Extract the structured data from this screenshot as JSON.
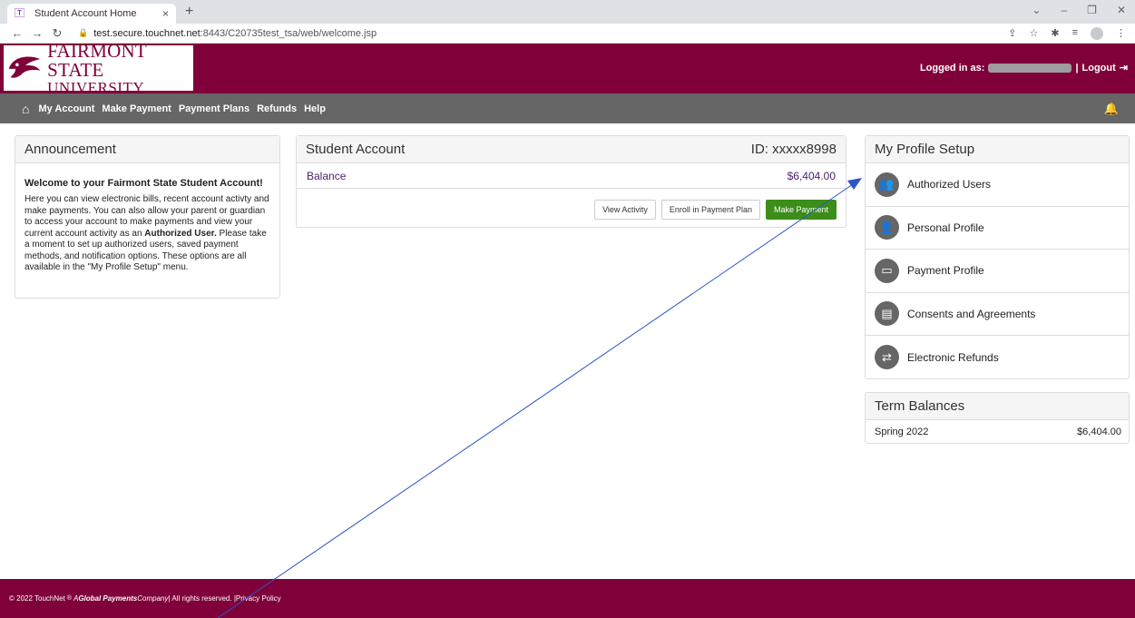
{
  "browser": {
    "tab_title": "Student Account Home",
    "tab_close": "×",
    "new_tab": "+",
    "url_host": "test.secure.touchnet.net",
    "url_rest": ":8443/C20735test_tsa/web/welcome.jsp"
  },
  "header": {
    "logo_line1": "FAIRMONT STATE",
    "logo_line2": "UNIVERSITY",
    "logged_in_label": "Logged in as:",
    "logout_label": "Logout",
    "brand_color": "#80003a"
  },
  "nav": {
    "items": [
      "My Account",
      "Make Payment",
      "Payment Plans",
      "Refunds",
      "Help"
    ]
  },
  "announcement": {
    "title": "Announcement",
    "welcome": "Welcome to your Fairmont State Student Account!",
    "body_part1": "Here you can view electronic bills, recent account activty and make payments.  You can also allow your parent or guardian to access your account to make payments and view your current account activity as an ",
    "body_bold": "Authorized User.",
    "body_part2": "  Please take a moment to set up authorized users, saved payment methods, and notification options.  These options are all available in the \"My Profile Setup\" menu."
  },
  "student_account": {
    "title": "Student Account",
    "id_label": "ID: xxxxx8998",
    "balance_label": "Balance",
    "balance_value": "$6,404.00",
    "buttons": {
      "view_activity": "View Activity",
      "enroll": "Enroll in Payment Plan",
      "make_payment": "Make Payment"
    }
  },
  "profile_setup": {
    "title": "My Profile Setup",
    "items": [
      {
        "label": "Authorized Users",
        "icon": "users-icon"
      },
      {
        "label": "Personal Profile",
        "icon": "person-icon"
      },
      {
        "label": "Payment Profile",
        "icon": "credit-card-icon"
      },
      {
        "label": "Consents and Agreements",
        "icon": "document-icon"
      },
      {
        "label": "Electronic Refunds",
        "icon": "refund-icon"
      }
    ]
  },
  "term_balances": {
    "title": "Term Balances",
    "rows": [
      {
        "term": "Spring 2022",
        "amount": "$6,404.00"
      }
    ]
  },
  "footer": {
    "copyright": "© 2022 TouchNet",
    "reg": "®",
    "company_italic_a": "A ",
    "company_bold": "Global Payments",
    "company_italic_b": " Company",
    "rights": " | All rights reserved. | ",
    "privacy": "Privacy Policy"
  },
  "colors": {
    "accent": "#80003a",
    "nav_bg": "#666666",
    "primary_button": "#3c8d1a",
    "link": "#4a1e6e",
    "annotation_arrow": "#2a56c6"
  }
}
